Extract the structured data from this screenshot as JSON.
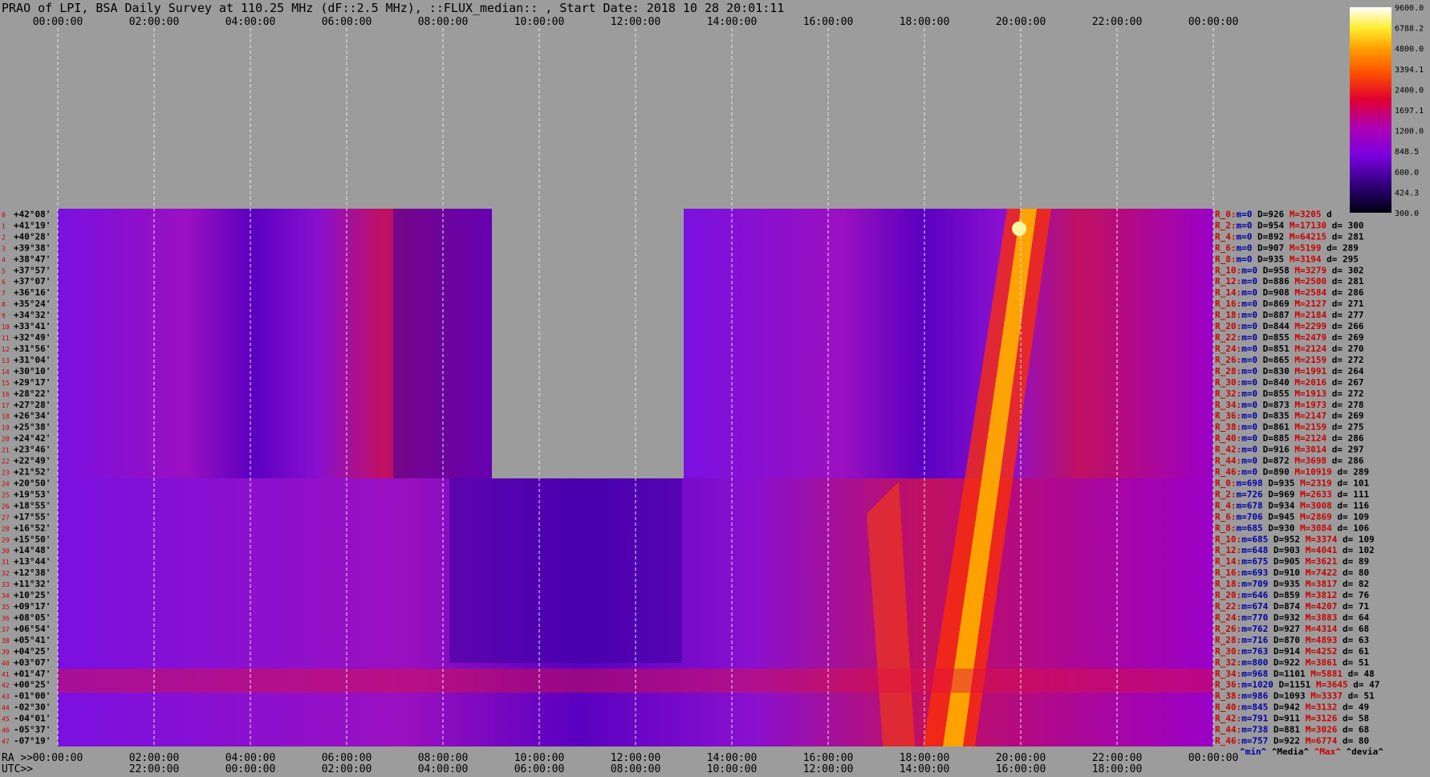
{
  "title": "PRAO of LPI, BSA Daily Survey at 110.25 MHz (dF::2.5 MHz), ::FLUX_median:: , Start Date: 2018 10 28 20:01:11",
  "footer": {
    "ra_label": "RA >>",
    "utc_label": "UTC>>"
  },
  "chart_data": {
    "type": "heatmap",
    "x_top_ticks": [
      "00:00:00",
      "02:00:00",
      "04:00:00",
      "06:00:00",
      "08:00:00",
      "10:00:00",
      "12:00:00",
      "14:00:00",
      "16:00:00",
      "18:00:00",
      "20:00:00",
      "22:00:00",
      "00:00:00"
    ],
    "x_bottom_ra_ticks": [
      "00:00:00",
      "02:00:00",
      "04:00:00",
      "06:00:00",
      "08:00:00",
      "10:00:00",
      "12:00:00",
      "14:00:00",
      "16:00:00",
      "18:00:00",
      "20:00:00",
      "22:00:00",
      "00:00:00"
    ],
    "x_bottom_utc_ticks": [
      "22:00:00",
      "00:00:00",
      "02:00:00",
      "04:00:00",
      "06:00:00",
      "08:00:00",
      "10:00:00",
      "12:00:00",
      "14:00:00",
      "16:00:00",
      "18:00:00"
    ],
    "colorbar_ticks": [
      "9600.0",
      "6788.2",
      "4800.0",
      "3394.1",
      "2400.0",
      "1697.1",
      "1200.0",
      "848.5",
      "600.0",
      "424.3",
      "300.0"
    ],
    "dec_labels": [
      "+42°08'",
      "+41°19'",
      "+40°28'",
      "+39°38'",
      "+38°47'",
      "+37°57'",
      "+37°07'",
      "+36°16'",
      "+35°24'",
      "+34°32'",
      "+33°41'",
      "+32°49'",
      "+31°56'",
      "+31°04'",
      "+30°10'",
      "+29°17'",
      "+28°22'",
      "+27°28'",
      "+26°34'",
      "+25°38'",
      "+24°42'",
      "+23°46'",
      "+22°49'",
      "+21°52'",
      "+20°50'",
      "+19°53'",
      "+18°55'",
      "+17°55'",
      "+16°52'",
      "+15°50'",
      "+14°48'",
      "+13°44'",
      "+12°38'",
      "+11°32'",
      "+10°25'",
      "+09°17'",
      "+08°05'",
      "+06°54'",
      "+05°41'",
      "+04°25'",
      "+03°07'",
      "+01°47'",
      "+00°25'",
      "-01°00'",
      "-02°30'",
      "-04°01'",
      "-05°37'",
      "-07°19'"
    ],
    "beam_stats": [
      {
        "r": "R_0:",
        "m": "m=0",
        "d": "D=926",
        "M": "M=3205",
        "dev": "d"
      },
      {
        "r": "R_2:",
        "m": "m=0",
        "d": "D=954",
        "M": "M=17130",
        "dev": "d= 300"
      },
      {
        "r": "R_4:",
        "m": "m=0",
        "d": "D=892",
        "M": "M=64215",
        "dev": "d= 281"
      },
      {
        "r": "R_6:",
        "m": "m=0",
        "d": "D=907",
        "M": "M=5199",
        "dev": "d= 289"
      },
      {
        "r": "R_8:",
        "m": "m=0",
        "d": "D=935",
        "M": "M=3194",
        "dev": "d= 295"
      },
      {
        "r": "R_10:",
        "m": "m=0",
        "d": "D=958",
        "M": "M=3279",
        "dev": "d= 302"
      },
      {
        "r": "R_12:",
        "m": "m=0",
        "d": "D=886",
        "M": "M=2500",
        "dev": "d= 281"
      },
      {
        "r": "R_14:",
        "m": "m=0",
        "d": "D=908",
        "M": "M=2584",
        "dev": "d= 286"
      },
      {
        "r": "R_16:",
        "m": "m=0",
        "d": "D=869",
        "M": "M=2127",
        "dev": "d= 271"
      },
      {
        "r": "R_18:",
        "m": "m=0",
        "d": "D=887",
        "M": "M=2184",
        "dev": "d= 277"
      },
      {
        "r": "R_20:",
        "m": "m=0",
        "d": "D=844",
        "M": "M=2299",
        "dev": "d= 266"
      },
      {
        "r": "R_22:",
        "m": "m=0",
        "d": "D=855",
        "M": "M=2479",
        "dev": "d= 269"
      },
      {
        "r": "R_24:",
        "m": "m=0",
        "d": "D=851",
        "M": "M=2124",
        "dev": "d= 270"
      },
      {
        "r": "R_26:",
        "m": "m=0",
        "d": "D=865",
        "M": "M=2159",
        "dev": "d= 272"
      },
      {
        "r": "R_28:",
        "m": "m=0",
        "d": "D=830",
        "M": "M=1991",
        "dev": "d= 264"
      },
      {
        "r": "R_30:",
        "m": "m=0",
        "d": "D=840",
        "M": "M=2016",
        "dev": "d= 267"
      },
      {
        "r": "R_32:",
        "m": "m=0",
        "d": "D=855",
        "M": "M=1913",
        "dev": "d= 272"
      },
      {
        "r": "R_34:",
        "m": "m=0",
        "d": "D=873",
        "M": "M=1973",
        "dev": "d= 278"
      },
      {
        "r": "R_36:",
        "m": "m=0",
        "d": "D=835",
        "M": "M=2147",
        "dev": "d= 269"
      },
      {
        "r": "R_38:",
        "m": "m=0",
        "d": "D=861",
        "M": "M=2159",
        "dev": "d= 275"
      },
      {
        "r": "R_40:",
        "m": "m=0",
        "d": "D=885",
        "M": "M=2124",
        "dev": "d= 286"
      },
      {
        "r": "R_42:",
        "m": "m=0",
        "d": "D=916",
        "M": "M=3014",
        "dev": "d= 297"
      },
      {
        "r": "R_44:",
        "m": "m=0",
        "d": "D=872",
        "M": "M=3698",
        "dev": "d= 286"
      },
      {
        "r": "R_46:",
        "m": "m=0",
        "d": "D=890",
        "M": "M=10919",
        "dev": "d= 289"
      },
      {
        "r": "R_0:",
        "m": "m=698",
        "d": "D=935",
        "M": "M=2319",
        "dev": "d= 101"
      },
      {
        "r": "R_2:",
        "m": "m=726",
        "d": "D=969",
        "M": "M=2633",
        "dev": "d= 111"
      },
      {
        "r": "R_4:",
        "m": "m=678",
        "d": "D=934",
        "M": "M=3008",
        "dev": "d= 116"
      },
      {
        "r": "R_6:",
        "m": "m=706",
        "d": "D=945",
        "M": "M=2869",
        "dev": "d= 109"
      },
      {
        "r": "R_8:",
        "m": "m=685",
        "d": "D=930",
        "M": "M=3084",
        "dev": "d= 106"
      },
      {
        "r": "R_10:",
        "m": "m=685",
        "d": "D=952",
        "M": "M=3374",
        "dev": "d= 109"
      },
      {
        "r": "R_12:",
        "m": "m=648",
        "d": "D=903",
        "M": "M=4041",
        "dev": "d= 102"
      },
      {
        "r": "R_14:",
        "m": "m=675",
        "d": "D=905",
        "M": "M=3621",
        "dev": "d= 89"
      },
      {
        "r": "R_16:",
        "m": "m=693",
        "d": "D=910",
        "M": "M=7422",
        "dev": "d= 80"
      },
      {
        "r": "R_18:",
        "m": "m=709",
        "d": "D=935",
        "M": "M=3817",
        "dev": "d= 82"
      },
      {
        "r": "R_20:",
        "m": "m=646",
        "d": "D=859",
        "M": "M=3812",
        "dev": "d= 76"
      },
      {
        "r": "R_22:",
        "m": "m=674",
        "d": "D=874",
        "M": "M=4207",
        "dev": "d= 71"
      },
      {
        "r": "R_24:",
        "m": "m=770",
        "d": "D=932",
        "M": "M=3883",
        "dev": "d= 64"
      },
      {
        "r": "R_26:",
        "m": "m=762",
        "d": "D=927",
        "M": "M=4314",
        "dev": "d= 68"
      },
      {
        "r": "R_28:",
        "m": "m=716",
        "d": "D=870",
        "M": "M=4893",
        "dev": "d= 63"
      },
      {
        "r": "R_30:",
        "m": "m=763",
        "d": "D=914",
        "M": "M=4252",
        "dev": "d= 61"
      },
      {
        "r": "R_32:",
        "m": "m=800",
        "d": "D=922",
        "M": "M=3861",
        "dev": "d= 51"
      },
      {
        "r": "R_34:",
        "m": "m=968",
        "d": "D=1101",
        "M": "M=5881",
        "dev": "d= 48"
      },
      {
        "r": "R_36:",
        "m": "m=1020",
        "d": "D=1151",
        "M": "M=3645",
        "dev": "d= 47"
      },
      {
        "r": "R_38:",
        "m": "m=986",
        "d": "D=1093",
        "M": "M=3337",
        "dev": "d= 51"
      },
      {
        "r": "R_40:",
        "m": "m=845",
        "d": "D=942",
        "M": "M=3132",
        "dev": "d= 49"
      },
      {
        "r": "R_42:",
        "m": "m=791",
        "d": "D=911",
        "M": "M=3126",
        "dev": "d= 58"
      },
      {
        "r": "R_44:",
        "m": "m=738",
        "d": "D=881",
        "M": "M=3026",
        "dev": "d= 68"
      },
      {
        "r": "R_46:",
        "m": "m=757",
        "d": "D=922",
        "M": "M=6774",
        "dev": "d= 80"
      }
    ],
    "legend_footer": [
      "^min^",
      "^Media^",
      "^Max^",
      "^devia^"
    ],
    "colors": {
      "grid": "#e8e8e8",
      "label_red": "#cc0000",
      "label_blue": "#0000aa",
      "label_black": "#000000"
    }
  }
}
